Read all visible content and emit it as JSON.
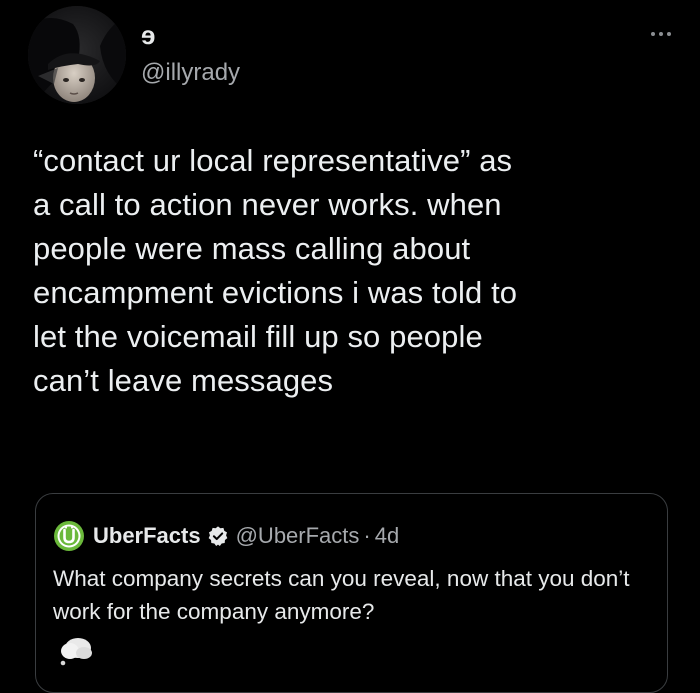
{
  "author": {
    "display_name": "ɘ",
    "handle": "@illyrady"
  },
  "tweet": {
    "text": "“contact ur local representative” as\na call to action never works. when\npeople were mass calling about\nencampment evictions i was told to\nlet the voicemail fill up so people\ncan’t leave messages"
  },
  "quoted_tweet": {
    "display_name": "UberFacts",
    "handle": "@UberFacts",
    "separator": "·",
    "time": "4d",
    "text": "What company secrets can you reveal, now that you don’t work for the company anymore?"
  },
  "icons": {
    "more": "more-horizontal-icon",
    "verified": "verified-badge-icon",
    "quoted_avatar": "uberfacts-logo-icon"
  },
  "colors": {
    "background": "#000000",
    "primary_text": "#e7e9ea",
    "secondary_text": "#a6a9ad",
    "border": "#3a3d40",
    "brand_green": "#6bb93b"
  }
}
